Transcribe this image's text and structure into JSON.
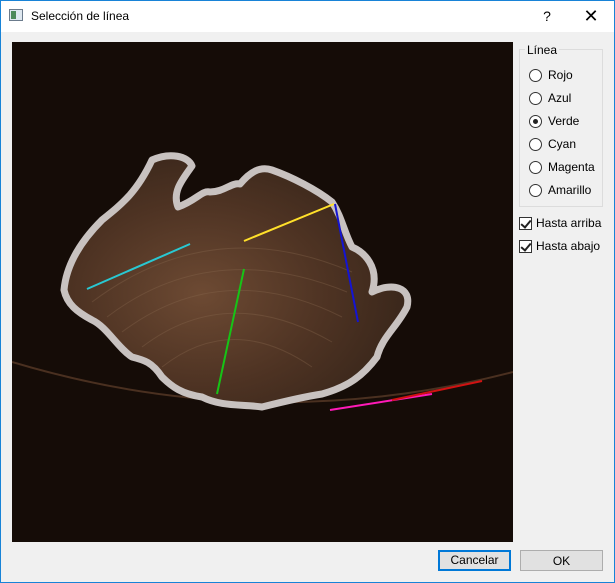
{
  "window": {
    "title": "Selección de línea",
    "help": "?",
    "close": "✕"
  },
  "line_group": {
    "title": "Línea",
    "options": [
      {
        "label": "Rojo",
        "checked": false
      },
      {
        "label": "Azul",
        "checked": false
      },
      {
        "label": "Verde",
        "checked": true
      },
      {
        "label": "Cyan",
        "checked": false
      },
      {
        "label": "Magenta",
        "checked": false
      },
      {
        "label": "Amarillo",
        "checked": false
      }
    ]
  },
  "checks": [
    {
      "label": "Hasta arriba",
      "checked": true
    },
    {
      "label": "Hasta abajo",
      "checked": true
    }
  ],
  "buttons": {
    "cancel": "Cancelar",
    "ok": "OK"
  },
  "lines": {
    "cyan": "#29c8d2",
    "yellow": "#ffe02a",
    "blue": "#1414d2",
    "green": "#16c416",
    "magenta": "#ff1ab8",
    "red": "#d01212"
  },
  "icons": {
    "app": "window-icon",
    "help": "help-icon",
    "close": "close-icon"
  }
}
